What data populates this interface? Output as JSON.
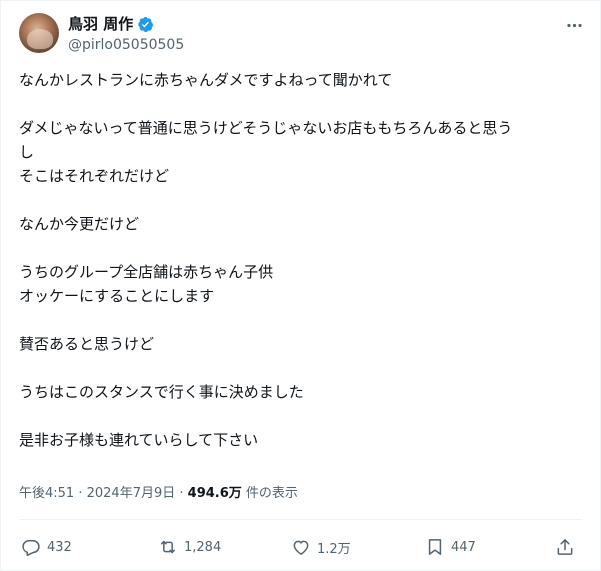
{
  "user": {
    "display_name": "鳥羽 周作",
    "handle": "@pirlo05050505",
    "verified": true,
    "verified_color": "#1d9bf0"
  },
  "post": {
    "lines": [
      "なんかレストランに赤ちゃんダメですよねって聞かれて",
      "",
      "ダメじゃないって普通に思うけどそうじゃないお店ももちろんあると思う",
      "し",
      "そこはそれぞれだけど",
      "",
      "なんか今更だけど",
      "",
      "うちのグループ全店舗は赤ちゃん子供",
      "オッケーにすることにします",
      "",
      "賛否あると思うけど",
      "",
      "うちはこのスタンスで行く事に決めました",
      "",
      "是非お子様も連れていらして下さい"
    ]
  },
  "meta": {
    "time": "午後4:51",
    "separator": " · ",
    "date": "2024年7月9日",
    "views": "494.6万",
    "views_suffix": " 件の表示"
  },
  "actions": {
    "reply_count": "432",
    "retweet_count": "1,284",
    "like_count": "1.2万",
    "bookmark_count": "447"
  },
  "icons": [
    "more-icon",
    "verified-icon",
    "reply-icon",
    "retweet-icon",
    "like-icon",
    "bookmark-icon",
    "share-icon"
  ]
}
